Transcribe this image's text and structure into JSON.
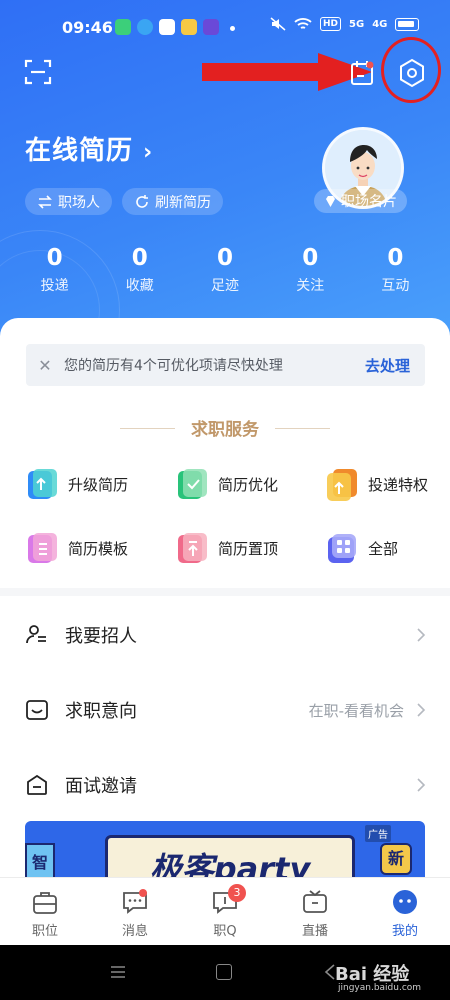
{
  "status_bar": {
    "time": "09:46",
    "hd_label": "HD",
    "network_5g": "5G",
    "network_4g": "4G"
  },
  "header": {
    "resume_title": "在线简历",
    "chips": [
      "职场人",
      "刷新简历"
    ],
    "card_badge": "职场名片"
  },
  "stats": [
    {
      "value": "0",
      "label": "投递"
    },
    {
      "value": "0",
      "label": "收藏"
    },
    {
      "value": "0",
      "label": "足迹"
    },
    {
      "value": "0",
      "label": "关注"
    },
    {
      "value": "0",
      "label": "互动"
    }
  ],
  "notice": {
    "text": "您的简历有4个可优化项请尽快处理",
    "action": "去处理"
  },
  "services": {
    "title": "求职服务",
    "items": [
      "升级简历",
      "简历优化",
      "投递特权",
      "简历模板",
      "简历置顶",
      "全部"
    ]
  },
  "menu": [
    {
      "label": "我要招人",
      "value": ""
    },
    {
      "label": "求职意向",
      "value": "在职-看看机会"
    },
    {
      "label": "面试邀请",
      "value": ""
    }
  ],
  "banner": {
    "text": "极客party",
    "tag": "广告",
    "new_label": "新",
    "left_label": "智"
  },
  "tabs": [
    {
      "label": "职位"
    },
    {
      "label": "消息"
    },
    {
      "label": "职Q",
      "badge": "3"
    },
    {
      "label": "直播"
    },
    {
      "label": "我的"
    }
  ],
  "watermark": {
    "text": "Bai 经验",
    "sub": "jingyan.baidu.com"
  },
  "colors": {
    "primary_blue": "#2f6ff5",
    "accent_gold": "#c1986a",
    "annotation_red": "#e32020",
    "badge_red": "#f0524f"
  }
}
